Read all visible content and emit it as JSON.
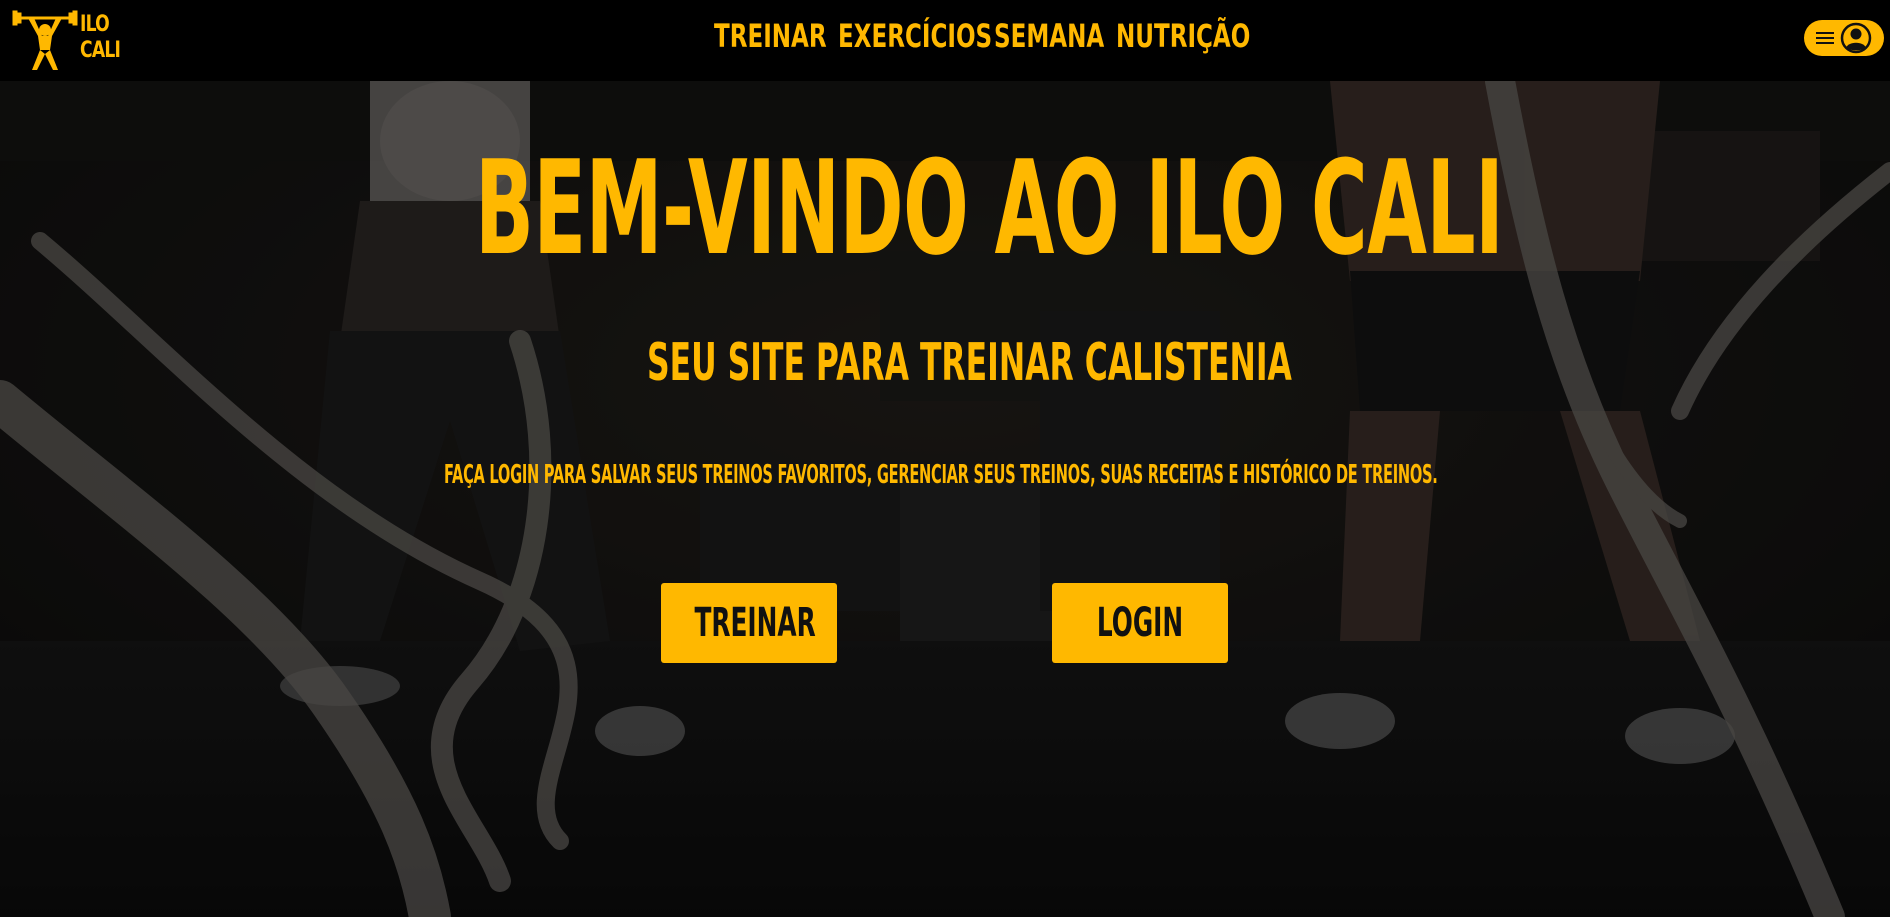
{
  "brand": {
    "line1": "ILO",
    "line2": "CALI",
    "icon": "weightlifter-icon",
    "accent": "#ffb800"
  },
  "nav": {
    "items": [
      {
        "label": "TREINAR"
      },
      {
        "label": "EXERCÍCIOS"
      },
      {
        "label": "SEMANA"
      },
      {
        "label": "NUTRIÇÃO"
      }
    ]
  },
  "user_menu": {
    "menu_icon": "hamburger-icon",
    "avatar_icon": "user-avatar-icon"
  },
  "hero": {
    "title": "BEM-VINDO AO ILO CALI",
    "subtitle": "SEU SITE PARA TREINAR CALISTENIA",
    "tagline": "FAÇA LOGIN PARA SALVAR SEUS TREINOS FAVORITOS, GERENCIAR SEUS TREINOS, SUAS RECEITAS E HISTÓRICO DE TREINOS.",
    "buttons": {
      "train": "TREINAR",
      "login": "LOGIN"
    }
  },
  "colors": {
    "background": "#000000",
    "accent": "#ffb800",
    "button_text": "#111111"
  }
}
